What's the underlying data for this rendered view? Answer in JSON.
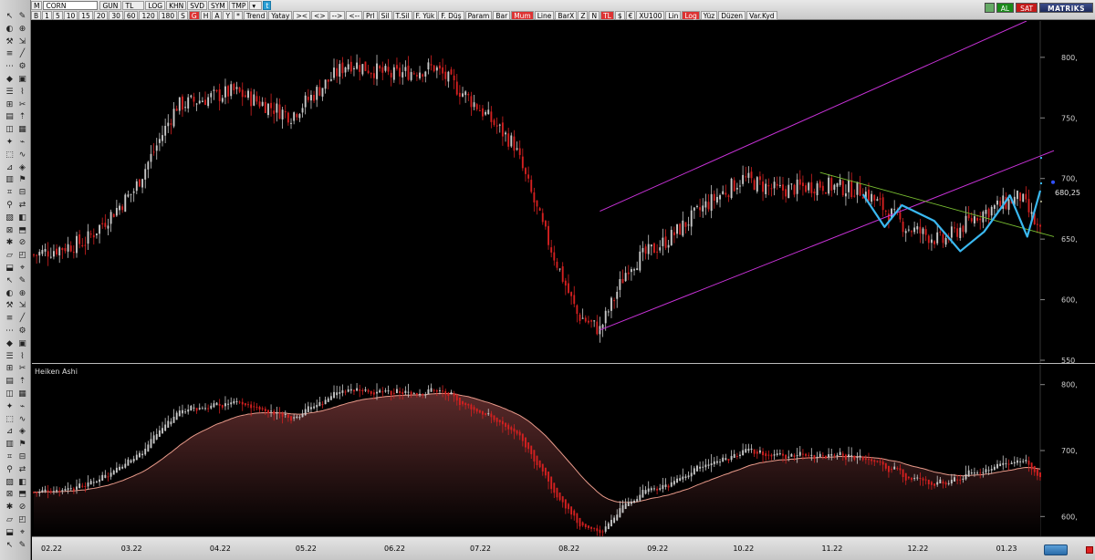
{
  "toolbar": {
    "symbol_prefix": "M",
    "symbol": "CORN",
    "row1": [
      "GUN",
      "TL",
      "LOG",
      "KHN",
      "SVD",
      "SYM",
      "TMP"
    ],
    "row2": [
      "B",
      "1",
      "5",
      "10",
      "15",
      "20",
      "30",
      "60",
      "120",
      "180",
      "S",
      "G",
      "H",
      "A",
      "Y",
      "*",
      "Trend",
      "Yatay",
      "><",
      "<>",
      "-->",
      "<--",
      "Prl",
      "Sil",
      "T.Sil",
      "F. Yük",
      "F. Düş",
      "Param",
      "Bar",
      "Mum",
      "Line",
      "BarX",
      "Z",
      "N",
      "TL",
      "$",
      "€",
      "XU100",
      "Lin",
      "Log",
      "Yüz",
      "Düzen",
      "Var.Kyd"
    ],
    "row2_active": [
      "G",
      "Mum",
      "TL",
      "Log"
    ],
    "right": {
      "al": "AL",
      "sat": "SAT",
      "brand": "MATRiKS"
    }
  },
  "price_chart": {
    "y_ticks": [
      "800,",
      "750,",
      "700,",
      "650,",
      "600,",
      "550"
    ],
    "last_price": "680,25",
    "fib_levels": [
      "#5bc8ff",
      "#5bc8ff",
      "#f4f4c4"
    ]
  },
  "indicator": {
    "title": "Heiken Ashi",
    "y_ticks": [
      "800,",
      "700,",
      "600,"
    ]
  },
  "x_axis": {
    "months": [
      "02.22",
      "03.22",
      "04.22",
      "05.22",
      "06.22",
      "07.22",
      "08.22",
      "09.22",
      "10.22",
      "11.22",
      "12.22",
      "01.23"
    ]
  },
  "colors": {
    "bull": "#c8c8c8",
    "bear": "#d42020",
    "channel": "#c832d8",
    "trendline": "#7ac032",
    "pattern": "#3ab8f0",
    "fill": "#3a1a1a"
  }
}
